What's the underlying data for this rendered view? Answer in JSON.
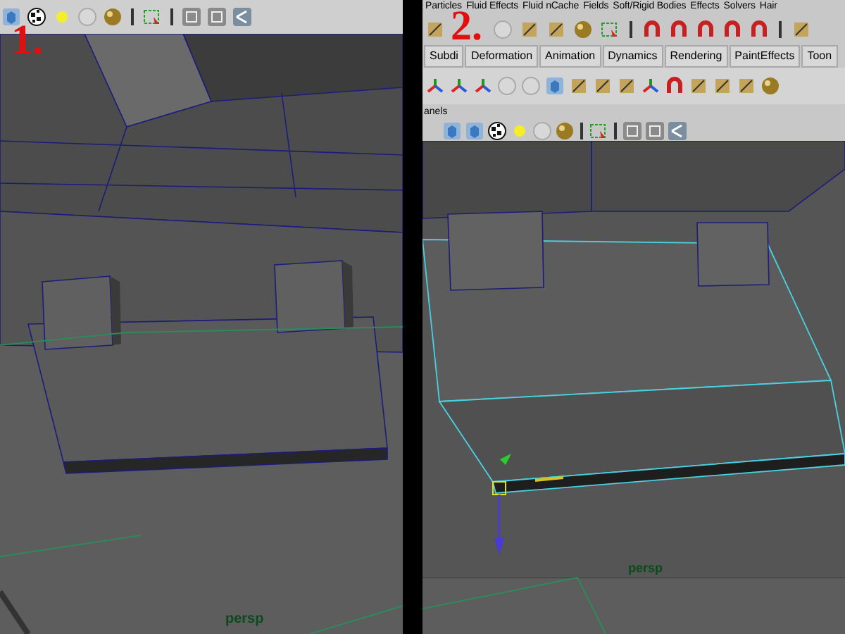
{
  "left_viewport": {
    "step": "1.",
    "camera": "persp"
  },
  "right_viewport": {
    "step": "2.",
    "menu_bar": [
      "Particles",
      "Fluid Effects",
      "Fluid nCache",
      "Fields",
      "Soft/Rigid Bodies",
      "Effects",
      "Solvers",
      "Hair"
    ],
    "shelf_tabs": [
      "Subdi",
      "Deformation",
      "Animation",
      "Dynamics",
      "Rendering",
      "PaintEffects",
      "Toon"
    ],
    "panel_menu": "anels",
    "camera": "persp"
  }
}
